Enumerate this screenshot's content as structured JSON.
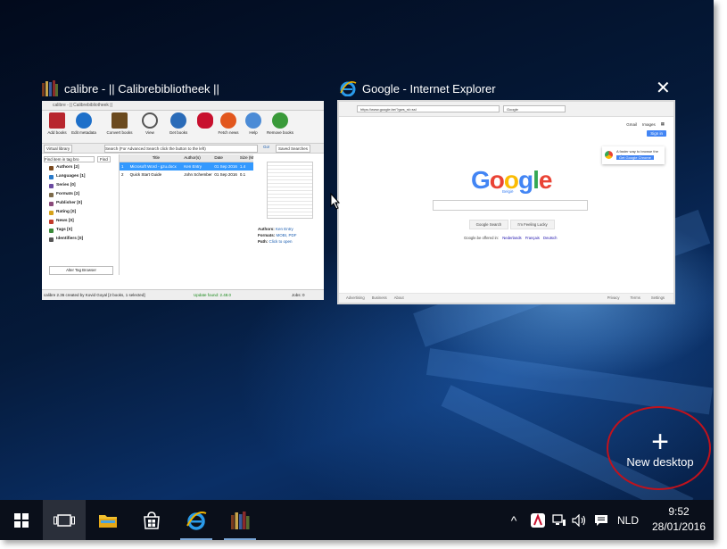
{
  "windows": [
    {
      "title": "calibre - || Calibrebibliotheek ||",
      "app": {
        "title_bar": "calibre - || Calibrebibliotheek ||",
        "toolbar": [
          "Add books",
          "Edit metadata",
          "Convert books",
          "View",
          "Get books",
          "Fetch news",
          "Help",
          "Remove books"
        ],
        "search_bar": {
          "virtual_library": "Virtual library",
          "find_placeholder": "Find item in tag bro",
          "find_button": "Find",
          "search_placeholder": "Search (For Advanced Search click the button to the left)",
          "go_button": "Go!",
          "saved_search": "Saved Searches"
        },
        "tag_browser": [
          {
            "label": "Authors [2]",
            "color": "#7b4a1e"
          },
          {
            "label": "Languages [1]",
            "color": "#2a7ac9"
          },
          {
            "label": "Series [0]",
            "color": "#6a4aa0"
          },
          {
            "label": "Formats [2]",
            "color": "#7c6a4a"
          },
          {
            "label": "Publisher [0]",
            "color": "#8a4a7a"
          },
          {
            "label": "Rating [0]",
            "color": "#d6a21a"
          },
          {
            "label": "News [0]",
            "color": "#c23a2a"
          },
          {
            "label": "Tags [0]",
            "color": "#3a8a3a"
          },
          {
            "label": "Identifiers [0]",
            "color": "#555555"
          }
        ],
        "alter_tag_browser": "Alter Tag Browser",
        "table": {
          "headers": [
            "Title",
            "Author(s)",
            "Date",
            "Size (M"
          ],
          "rows": [
            {
              "num": "1",
              "title": "Microsoft Word - gzu.docx",
              "author": "Ken Entry",
              "date": "01 Sep 2016",
              "size": "1.4"
            },
            {
              "num": "2",
              "title": "Quick Start Guide",
              "author": "John Schember",
              "date": "01 Sep 2016",
              "size": "0.1"
            }
          ]
        },
        "details": {
          "authors_label": "Authors:",
          "authors_value": "Ken Entry",
          "formats_label": "Formats:",
          "formats_value": "MOBI, PDF",
          "path_label": "Path:",
          "path_value": "Click to open"
        },
        "status_left": "calibre 2.36 created by Kovid Goyal  [2 books, 1 selected]",
        "update_found": "Update found: 2.48.0",
        "jobs": "Jobs: 0"
      }
    },
    {
      "title": "Google - Internet Explorer",
      "close_glyph": "✕",
      "browser": {
        "address": "https://www.google.be/?gws_rd=ssl",
        "tab_label": "Google",
        "header_links": [
          "Gmail",
          "Images"
        ],
        "sign_in": "Sign in",
        "promo_text": "A faster way to browse the web",
        "promo_button": "Get Google Chrome",
        "logo_letters": [
          {
            "ch": "G",
            "color": "#4285f4"
          },
          {
            "ch": "o",
            "color": "#ea4335"
          },
          {
            "ch": "o",
            "color": "#fbbc05"
          },
          {
            "ch": "g",
            "color": "#4285f4"
          },
          {
            "ch": "l",
            "color": "#34a853"
          },
          {
            "ch": "e",
            "color": "#ea4335"
          }
        ],
        "logo_sub": "België",
        "search_button": "Google Search",
        "lucky_button": "I'm Feeling Lucky",
        "offered_in": "Google.be offered in:",
        "languages": [
          "Nederlands",
          "Français",
          "Deutsch"
        ],
        "footer_left": [
          "Advertising",
          "Business",
          "About"
        ],
        "footer_right": [
          "Privacy",
          "Terms",
          "Settings"
        ]
      }
    }
  ],
  "new_desktop": {
    "glyph": "+",
    "label": "New desktop"
  },
  "taskbar": {
    "icons": [
      "windows-start-icon",
      "task-view-icon",
      "file-explorer-icon",
      "store-icon",
      "internet-explorer-icon",
      "calibre-icon"
    ],
    "tray": {
      "language": "NLD",
      "up_arrow": "^"
    },
    "clock": {
      "time": "9:52",
      "date": "28/01/2016"
    }
  },
  "colors": {
    "annotation_ring": "#c1121c",
    "accent": "#4285f4",
    "taskbar": "#0a0f1a"
  }
}
